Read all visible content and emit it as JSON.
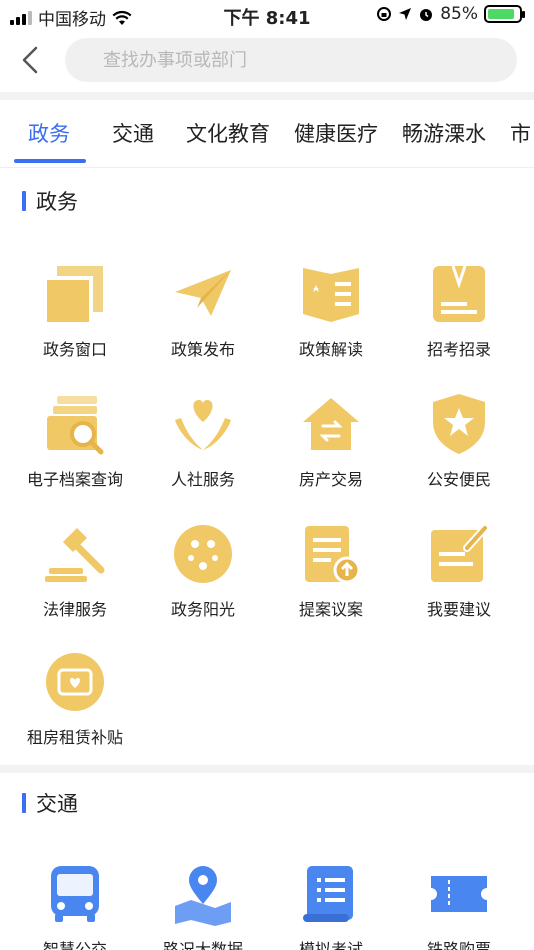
{
  "status_bar": {
    "carrier": "中国移动",
    "time": "下午 8:41",
    "battery": "85%"
  },
  "search": {
    "placeholder": "查找办事项或部门"
  },
  "tabs": [
    {
      "label": "政务"
    },
    {
      "label": "交通"
    },
    {
      "label": "文化教育"
    },
    {
      "label": "健康医疗"
    },
    {
      "label": "畅游溧水"
    },
    {
      "label": "市"
    }
  ],
  "sections": [
    {
      "title": "政务",
      "items": [
        {
          "label": "政务窗口",
          "icon": "window-icon"
        },
        {
          "label": "政策发布",
          "icon": "paper-plane-icon"
        },
        {
          "label": "政策解读",
          "icon": "open-book-icon"
        },
        {
          "label": "招考招录",
          "icon": "exam-icon"
        },
        {
          "label": "电子档案查询",
          "icon": "archive-search-icon"
        },
        {
          "label": "人社服务",
          "icon": "heart-hands-icon"
        },
        {
          "label": "房产交易",
          "icon": "house-exchange-icon"
        },
        {
          "label": "公安便民",
          "icon": "police-shield-icon"
        },
        {
          "label": "法律服务",
          "icon": "gavel-icon"
        },
        {
          "label": "政务阳光",
          "icon": "stars-circle-icon"
        },
        {
          "label": "提案议案",
          "icon": "proposal-icon"
        },
        {
          "label": "我要建议",
          "icon": "suggest-edit-icon"
        },
        {
          "label": "租房租赁补贴",
          "icon": "rent-subsidy-icon"
        }
      ]
    },
    {
      "title": "交通",
      "items": [
        {
          "label": "智慧公交",
          "icon": "bus-icon"
        },
        {
          "label": "路况大数据",
          "icon": "map-pin-icon"
        },
        {
          "label": "模拟考试",
          "icon": "exam-scroll-icon"
        },
        {
          "label": "铁路购票",
          "icon": "ticket-icon"
        }
      ]
    }
  ],
  "colors": {
    "accent": "#3a6ff2",
    "icon_gold": "#f0c865",
    "icon_blue": "#4a86f0"
  }
}
